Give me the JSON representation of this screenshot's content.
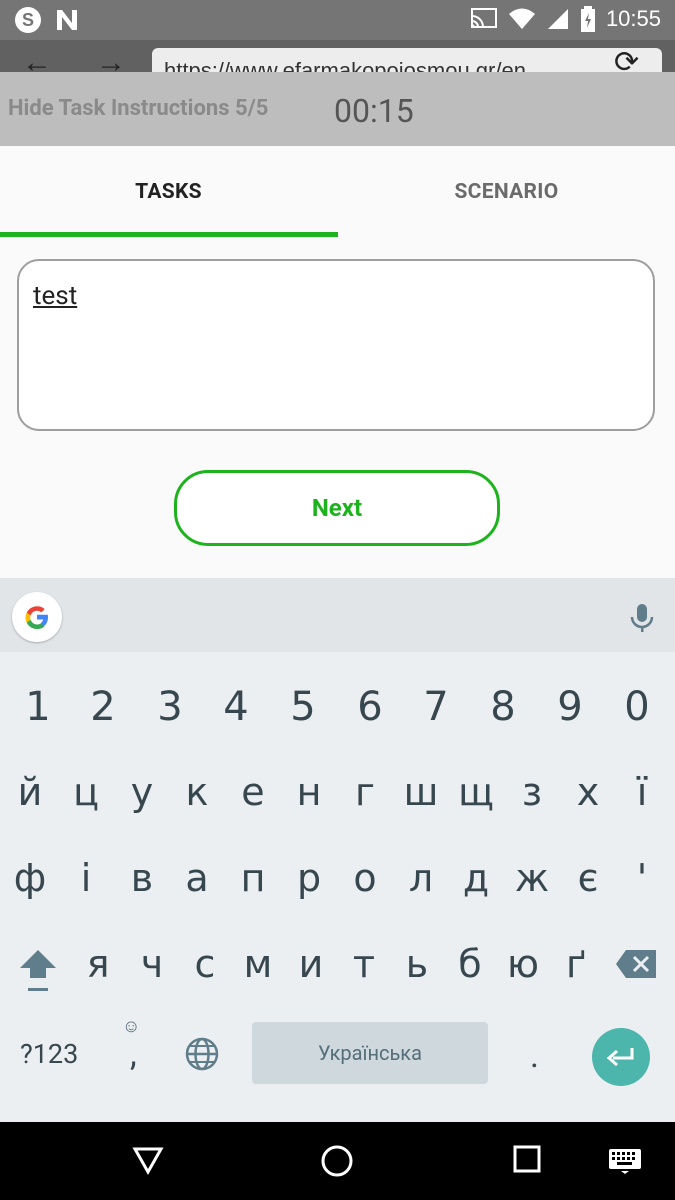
{
  "status_bar": {
    "time": "10:55",
    "icons": [
      "skype-icon",
      "n-icon",
      "cast-icon",
      "wifi-icon",
      "signal-icon",
      "battery-icon"
    ]
  },
  "browser": {
    "url": "https://www.efarmakopoiosmou.gr/en"
  },
  "task_overlay": {
    "hide_label": "Hide Task Instructions 5/5",
    "timer": "00:15"
  },
  "tabs": [
    {
      "label": "TASKS",
      "active": true
    },
    {
      "label": "SCENARIO",
      "active": false
    }
  ],
  "task_text": "test",
  "next_label": "Next",
  "keyboard": {
    "numbers": [
      "1",
      "2",
      "3",
      "4",
      "5",
      "6",
      "7",
      "8",
      "9",
      "0"
    ],
    "row1": [
      "й",
      "ц",
      "у",
      "к",
      "е",
      "н",
      "г",
      "ш",
      "щ",
      "з",
      "х",
      "ї"
    ],
    "row2": [
      "ф",
      "і",
      "в",
      "а",
      "п",
      "р",
      "о",
      "л",
      "д",
      "ж",
      "є",
      "'"
    ],
    "row3": [
      "я",
      "ч",
      "с",
      "м",
      "и",
      "т",
      "ь",
      "б",
      "ю",
      "ґ"
    ],
    "sym_label": "?123",
    "comma": ",",
    "period": ".",
    "space_label": "Українська"
  },
  "colors": {
    "accent": "#1db31d",
    "enter_key": "#4db6ac",
    "status_bar": "#757575",
    "overlay": "#bdbdbd"
  }
}
